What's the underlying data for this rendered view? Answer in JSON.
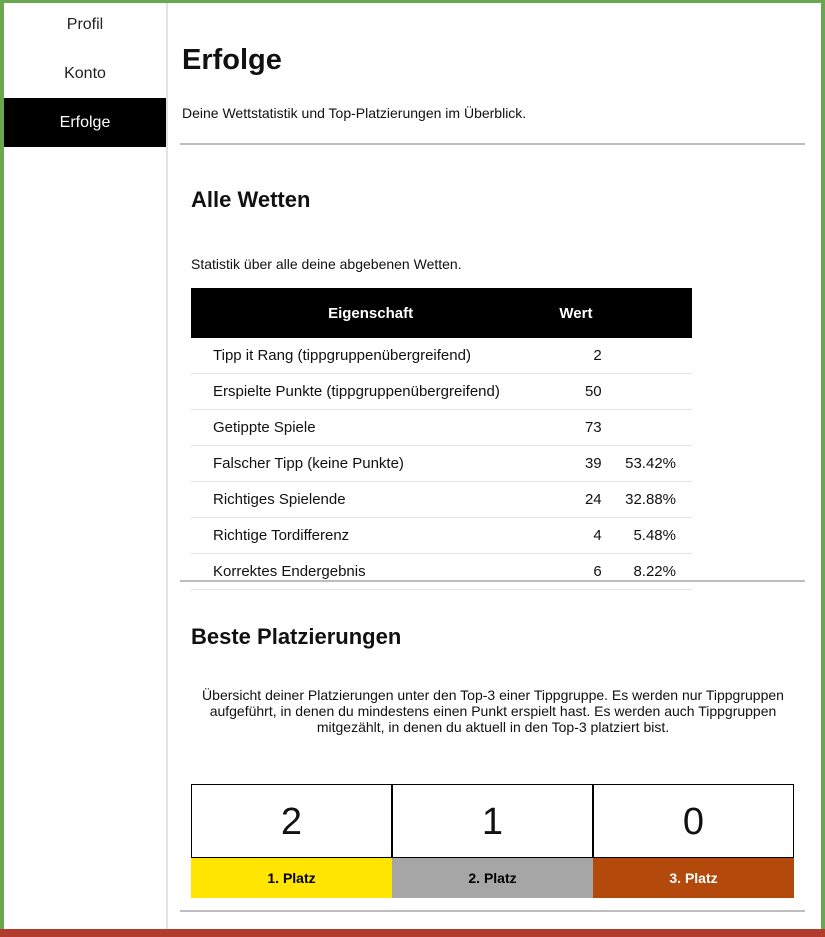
{
  "sidebar": {
    "items": [
      {
        "label": "Profil"
      },
      {
        "label": "Konto"
      },
      {
        "label": "Erfolge"
      }
    ]
  },
  "page": {
    "title": "Erfolge",
    "description": "Deine Wettstatistik und Top-Platzierungen im Überblick."
  },
  "all_bets": {
    "title": "Alle Wetten",
    "description": "Statistik über alle deine abgebenen Wetten.",
    "columns": [
      "Eigenschaft",
      "Wert"
    ],
    "rows": [
      {
        "property": "Tipp it Rang (tippgruppenübergreifend)",
        "value": "2",
        "percent": ""
      },
      {
        "property": "Erspielte Punkte (tippgruppenübergreifend)",
        "value": "50",
        "percent": ""
      },
      {
        "property": "Getippte Spiele",
        "value": "73",
        "percent": ""
      },
      {
        "property": "Falscher Tipp (keine Punkte)",
        "value": "39",
        "percent": "53.42%"
      },
      {
        "property": "Richtiges Spielende",
        "value": "24",
        "percent": "32.88%"
      },
      {
        "property": "Richtige Tordifferenz",
        "value": "4",
        "percent": "5.48%"
      },
      {
        "property": "Korrektes Endergebnis",
        "value": "6",
        "percent": "8.22%"
      }
    ]
  },
  "best_placements": {
    "title": "Beste Platzierungen",
    "description": "Übersicht deiner Platzierungen unter den Top-3 einer Tippgruppe. Es werden nur Tippgruppen aufgeführt, in denen du mindestens einen Punkt erspielt hast. Es werden auch Tippgruppen mitgezählt, in denen du aktuell in den Top-3 platziert bist.",
    "places": [
      {
        "count": "2",
        "label": "1. Platz",
        "color": "#ffe500",
        "text_color": "#000000"
      },
      {
        "count": "1",
        "label": "2. Platz",
        "color": "#a6a6a6",
        "text_color": "#000000"
      },
      {
        "count": "0",
        "label": "3. Platz",
        "color": "#b34a0c",
        "text_color": "#ffffff"
      }
    ]
  },
  "colors": {
    "frame_green": "#6aa84f",
    "frame_red": "#b23b2e",
    "active_nav": "#000000"
  }
}
